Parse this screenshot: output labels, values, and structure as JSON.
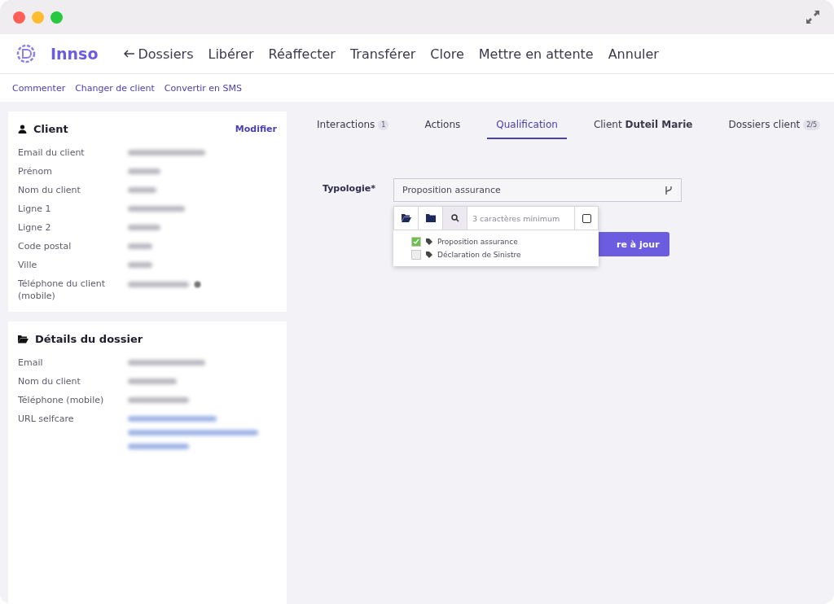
{
  "window": {
    "controls": [
      {
        "color": "#fe5f57"
      },
      {
        "color": "#febc2e"
      },
      {
        "color": "#28c840"
      }
    ]
  },
  "header": {
    "logo": "Innso",
    "actions": [
      {
        "label": "Dossiers",
        "kind": "back"
      },
      {
        "label": "Libérer",
        "kind": "plain"
      },
      {
        "label": "Réaffecter",
        "kind": "plain"
      },
      {
        "label": "Transférer",
        "kind": "plain"
      },
      {
        "label": "Clore",
        "kind": "plain"
      },
      {
        "label": "Mettre en attente",
        "kind": "plain"
      },
      {
        "label": "Annuler",
        "kind": "plain"
      }
    ]
  },
  "subactions": [
    "Commenter",
    "Changer de client",
    "Convertir en SMS"
  ],
  "client_card": {
    "title": "Client",
    "edit": "Modifier",
    "fields": [
      {
        "label": "Email du client",
        "redacted": true,
        "kind": "text"
      },
      {
        "label": "Prénom",
        "redacted": true,
        "kind": "text"
      },
      {
        "label": "Nom du client",
        "redacted": true,
        "kind": "text"
      },
      {
        "label": "Ligne 1",
        "redacted": true,
        "kind": "text"
      },
      {
        "label": "Ligne 2",
        "redacted": true,
        "kind": "text"
      },
      {
        "label": "Code postal",
        "redacted": true,
        "kind": "text"
      },
      {
        "label": "Ville",
        "redacted": true,
        "kind": "text"
      },
      {
        "label": "Téléphone du client (mobile)",
        "redacted": true,
        "kind": "phone"
      }
    ]
  },
  "case_card": {
    "title": "Détails du dossier",
    "fields": [
      {
        "label": "Email",
        "redacted": true,
        "kind": "text"
      },
      {
        "label": "Nom du client",
        "redacted": true,
        "kind": "text"
      },
      {
        "label": "Téléphone (mobile)",
        "redacted": true,
        "kind": "text"
      },
      {
        "label": "URL selfcare",
        "redacted": true,
        "kind": "link"
      }
    ]
  },
  "tabs": [
    {
      "label": "Interactions",
      "count": "1",
      "selected": false
    },
    {
      "label": "Actions",
      "selected": false
    },
    {
      "label": "Qualification",
      "selected": true
    },
    {
      "label": "Client **Duteil Marie**",
      "selected": false
    },
    {
      "label": "Dossiers client",
      "count": "2/5",
      "selected": false
    }
  ],
  "form": {
    "label": "Typologie*",
    "value": "Proposition assurance",
    "dropdown": {
      "search_placeholder": "3 caractères minimum",
      "select_all_checked": false,
      "items": [
        {
          "label": "Proposition assurance",
          "checked": true
        },
        {
          "label": "Déclaration de Sinistre",
          "checked": false
        }
      ]
    },
    "submit": "re à jour"
  }
}
